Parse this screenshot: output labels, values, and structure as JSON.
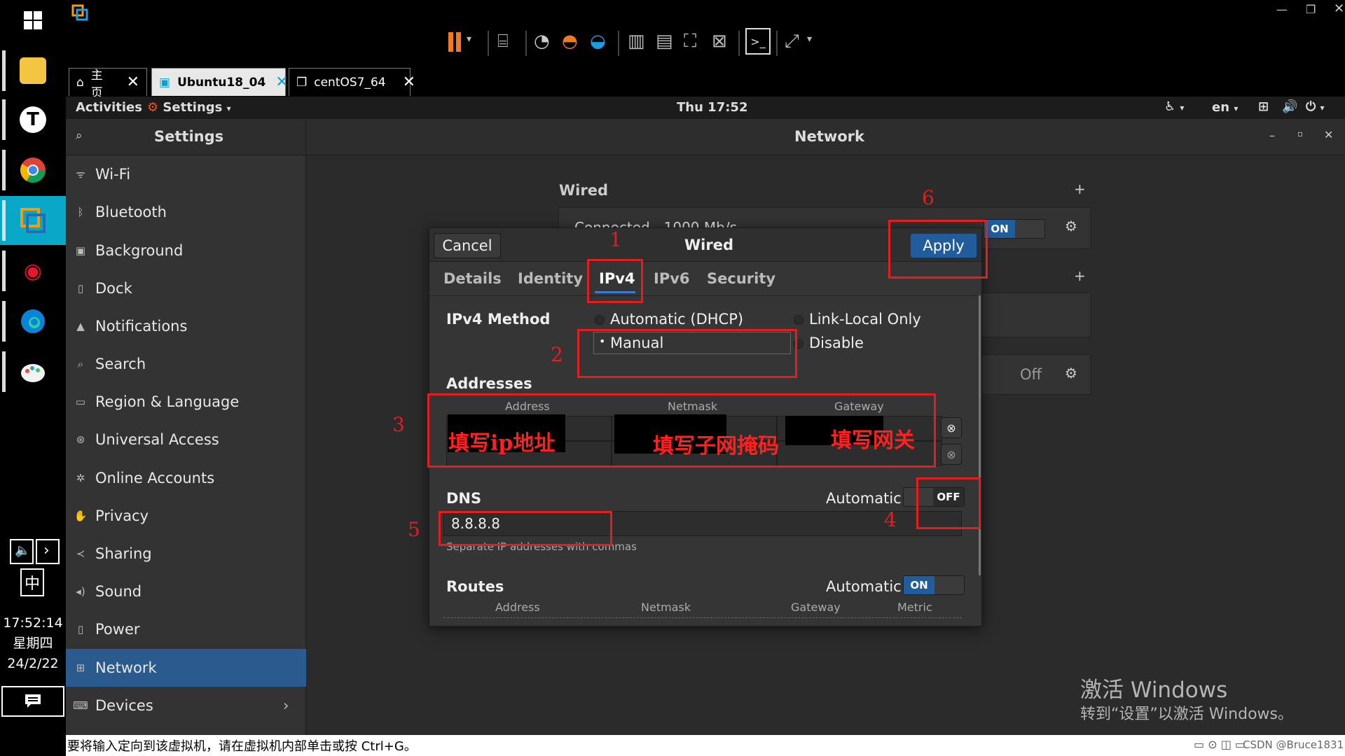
{
  "taskbar": {
    "ime": "中",
    "clock_time": "17:52:14",
    "clock_day": "星期四",
    "clock_date": "24/2/22"
  },
  "vm_tabs": [
    {
      "label": "主页"
    },
    {
      "label": "Ubuntu18_04"
    },
    {
      "label": "centOS7_64"
    }
  ],
  "gnome": {
    "activities": "Activities",
    "app_menu": "Settings",
    "clock": "Thu 17:52",
    "lang": "en"
  },
  "settings": {
    "title": "Settings",
    "page_title": "Network",
    "sidebar": [
      {
        "label": "Wi-Fi",
        "icon": "wifi-icon"
      },
      {
        "label": "Bluetooth",
        "icon": "bluetooth-icon"
      },
      {
        "label": "Background",
        "icon": "background-icon"
      },
      {
        "label": "Dock",
        "icon": "dock-icon"
      },
      {
        "label": "Notifications",
        "icon": "bell-icon"
      },
      {
        "label": "Search",
        "icon": "search-icon"
      },
      {
        "label": "Region & Language",
        "icon": "region-icon"
      },
      {
        "label": "Universal Access",
        "icon": "accessibility-icon"
      },
      {
        "label": "Online Accounts",
        "icon": "online-accounts-icon"
      },
      {
        "label": "Privacy",
        "icon": "privacy-icon"
      },
      {
        "label": "Sharing",
        "icon": "share-icon"
      },
      {
        "label": "Sound",
        "icon": "speaker-icon"
      },
      {
        "label": "Power",
        "icon": "power-icon"
      },
      {
        "label": "Network",
        "icon": "network-icon"
      },
      {
        "label": "Devices",
        "icon": "devices-icon"
      }
    ],
    "active_item": "Network"
  },
  "network": {
    "wired_heading": "Wired",
    "wired_status": "Connected - 1000 Mb/s",
    "wired_toggle": "ON",
    "proxy_toggle": "Off"
  },
  "dialog": {
    "title": "Wired",
    "cancel": "Cancel",
    "apply": "Apply",
    "tabs": [
      "Details",
      "Identity",
      "IPv4",
      "IPv6",
      "Security"
    ],
    "active_tab": "IPv4",
    "method_label": "IPv4 Method",
    "methods": [
      "Automatic (DHCP)",
      "Link-Local Only",
      "Manual",
      "Disable"
    ],
    "selected_method": "Manual",
    "addresses_label": "Addresses",
    "addr_headers": [
      "Address",
      "Netmask",
      "Gateway"
    ],
    "dns_label": "DNS",
    "dns_automatic_label": "Automatic",
    "dns_toggle": "OFF",
    "dns_value": "8.8.8.8",
    "dns_hint": "Separate IP addresses with commas",
    "routes_label": "Routes",
    "routes_automatic_label": "Automatic",
    "routes_toggle": "ON",
    "route_headers": [
      "Address",
      "Netmask",
      "Gateway",
      "Metric"
    ]
  },
  "annotations": {
    "numbers": [
      "1",
      "2",
      "3",
      "4",
      "5",
      "6"
    ],
    "fill_ip": "填写ip地址",
    "fill_netmask": "填写子网掩码",
    "fill_gateway": "填写网关",
    "color": "#e41e1e"
  },
  "watermark": {
    "line1": "激活 Windows",
    "line2": "转到“设置”以激活 Windows。"
  },
  "statusbar": {
    "message": "要将输入定向到该虚拟机，请在虚拟机内部单击或按 Ctrl+G。",
    "credit": "CSDN @Bruce1831"
  }
}
